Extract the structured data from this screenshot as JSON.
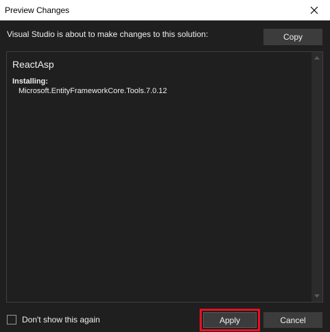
{
  "dialog": {
    "title": "Preview Changes",
    "intro": "Visual Studio is about to make changes to this solution:",
    "copy_label": "Copy"
  },
  "changes": {
    "project": "ReactAsp",
    "action": "Installing:",
    "package": "Microsoft.EntityFrameworkCore.Tools.7.0.12"
  },
  "footer": {
    "dont_show_label": "Don't show this again",
    "dont_show_checked": false,
    "apply_label": "Apply",
    "cancel_label": "Cancel"
  },
  "colors": {
    "highlight": "#e81123",
    "background": "#1f1f1f",
    "button": "#3c3c3c"
  },
  "icons": {
    "close": "close-icon",
    "scroll_up": "chevron-up-icon",
    "scroll_down": "chevron-down-icon"
  }
}
